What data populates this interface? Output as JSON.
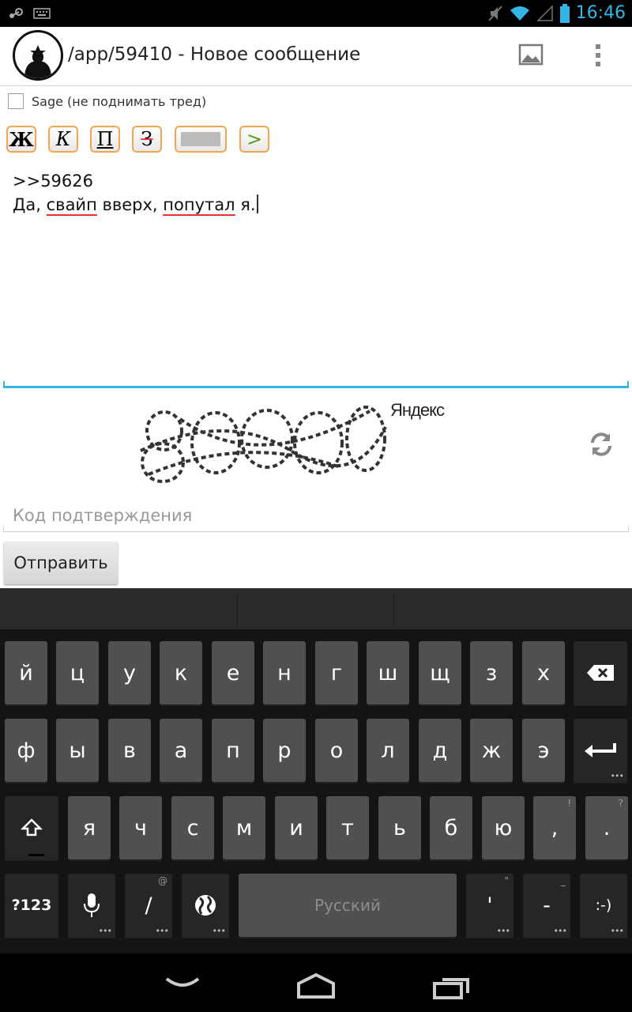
{
  "app": {
    "title": "/app/59410 - Новое сообщение"
  },
  "status": {
    "time": "16:46"
  },
  "form": {
    "sage_label": "Sage (не поднимать тред)",
    "format_buttons": [
      "Ж",
      "К",
      "П",
      "З",
      "",
      ">"
    ],
    "message_line1": ">>59626",
    "message_line2_parts": [
      "Да, ",
      "свайп",
      " вверх, ",
      "попутал",
      " я."
    ],
    "captcha_provider": "Яндекс",
    "code_placeholder": "Код подтверждения",
    "send_label": "Отправить"
  },
  "keyboard": {
    "row1": [
      "й",
      "ц",
      "у",
      "к",
      "е",
      "н",
      "г",
      "ш",
      "щ",
      "з",
      "х"
    ],
    "row2": [
      "ф",
      "ы",
      "в",
      "а",
      "п",
      "р",
      "о",
      "л",
      "д",
      "ж",
      "э"
    ],
    "row3": [
      "я",
      "ч",
      "с",
      "м",
      "и",
      "т",
      "ь",
      "б",
      "ю",
      ",",
      "."
    ],
    "row3_hints": {
      "9": "!",
      "10": "?"
    },
    "sym_label": "?123",
    "slash_label": "/",
    "slash_hint": "@",
    "space_label": "Русский",
    "apostrophe_label": "'",
    "apostrophe_hint": "\"",
    "dash_label": "-",
    "dash_hint": "_",
    "smiley_label": ":-)"
  },
  "colors": {
    "accent": "#33b5e5",
    "format_border": "#f2a650",
    "error_underline": "#ee3333"
  },
  "icons": [
    "steam-icon",
    "keyboard-icon",
    "mute-icon",
    "wifi-icon",
    "signal-icon",
    "battery-icon",
    "image-icon",
    "overflow-menu-icon",
    "refresh-icon",
    "backspace-icon",
    "enter-icon",
    "shift-icon",
    "mic-icon",
    "globe-icon",
    "back-icon",
    "home-icon",
    "recents-icon"
  ]
}
